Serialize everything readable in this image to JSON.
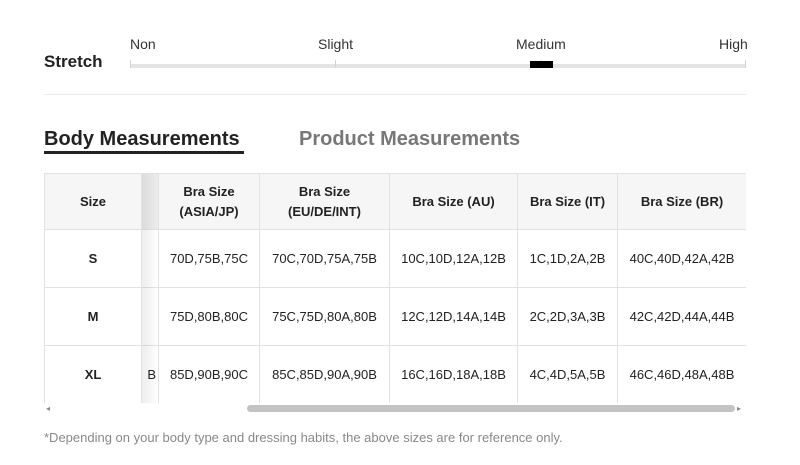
{
  "stretch": {
    "label": "Stretch",
    "levels": [
      "Non",
      "Slight",
      "Medium",
      "High"
    ],
    "selected": "Medium"
  },
  "tabs": {
    "body": "Body Measurements",
    "product": "Product Measurements",
    "active": "Body Measurements"
  },
  "table": {
    "headers": {
      "size": "Size",
      "asia_line1": "Bra Size",
      "asia_line2": "(ASIA/JP)",
      "eu_line1": "Bra Size",
      "eu_line2": "(EU/DE/INT)",
      "au": "Bra Size (AU)",
      "it": "Bra Size (IT)",
      "br": "Bra Size (BR)"
    },
    "rows": [
      {
        "size": "S",
        "hidden": "",
        "asia": "70D,75B,75C",
        "eu": "70C,70D,75A,75B",
        "au": "10C,10D,12A,12B",
        "it": "1C,1D,2A,2B",
        "br": "40C,40D,42A,42B"
      },
      {
        "size": "M",
        "hidden": "",
        "asia": "75D,80B,80C",
        "eu": "75C,75D,80A,80B",
        "au": "12C,12D,14A,14B",
        "it": "2C,2D,3A,3B",
        "br": "42C,42D,44A,44B"
      },
      {
        "size": "XL",
        "hidden": "B",
        "asia": "85D,90B,90C",
        "eu": "85C,85D,90A,90B",
        "au": "16C,16D,18A,18B",
        "it": "4C,4D,5A,5B",
        "br": "46C,46D,48A,48B"
      }
    ]
  },
  "scrollbar": {
    "left_arrow": "◂",
    "right_arrow": "▸"
  },
  "footnote": "*Depending on your body type and dressing habits, the above sizes are for reference only."
}
